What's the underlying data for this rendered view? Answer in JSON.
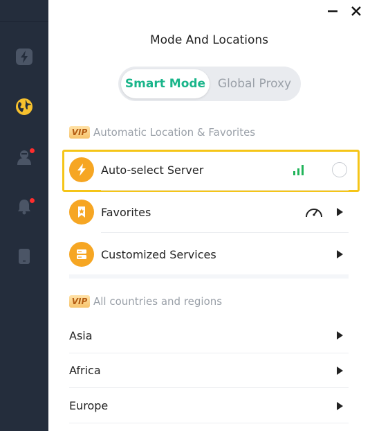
{
  "window": {
    "title": "Mode And Locations",
    "minimize_icon": "minimize-icon",
    "close_icon": "close-icon"
  },
  "sidebar": {
    "items": [
      {
        "name": "connect",
        "icon": "lightning-icon"
      },
      {
        "name": "locations",
        "icon": "globe-icon",
        "active": true
      },
      {
        "name": "account",
        "icon": "user-icon",
        "badge": true
      },
      {
        "name": "notifications",
        "icon": "bell-icon",
        "badge": true
      },
      {
        "name": "devices",
        "icon": "device-icon"
      }
    ]
  },
  "mode_toggle": {
    "smart_label": "Smart Mode",
    "global_label": "Global Proxy",
    "selected": "Smart Mode"
  },
  "favorites_section": {
    "vip_badge": "VIP",
    "title": "Automatic Location & Favorites",
    "items": [
      {
        "label": "Auto-select Server",
        "icon": "lightning-icon",
        "signal_icon": "signal-bars-icon",
        "radio": "unselected",
        "highlighted": true
      },
      {
        "label": "Favorites",
        "icon": "bookmark-icon",
        "extra_icon": "speedometer-icon"
      },
      {
        "label": "Customized Services",
        "icon": "server-icon"
      }
    ]
  },
  "regions_section": {
    "vip_badge": "VIP",
    "title": "All countries and regions",
    "items": [
      {
        "label": "Asia"
      },
      {
        "label": "Africa"
      },
      {
        "label": "Europe"
      }
    ]
  },
  "colors": {
    "sidebar_bg": "#242d3c",
    "accent_green": "#19b58a",
    "highlight_border": "#f5c518",
    "icon_orange": "#f6a623",
    "badge_red": "#ff2d2d"
  }
}
